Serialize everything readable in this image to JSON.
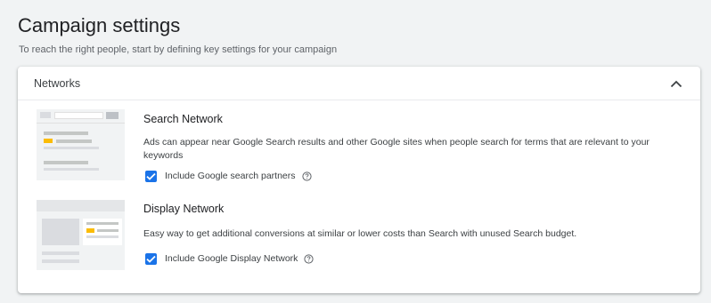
{
  "page": {
    "title": "Campaign settings",
    "subtitle": "To reach the right people, start by defining key settings for your campaign"
  },
  "networks_panel": {
    "title": "Networks",
    "collapse_icon": "chevron-up-icon",
    "search_network": {
      "title": "Search Network",
      "description": "Ads can appear near Google Search results and other Google sites when people search for terms that are relevant to your keywords",
      "checkbox_label": "Include Google search partners",
      "checked": true,
      "help_icon": "help-circle-icon",
      "illustration_icon": "search-results-illustration"
    },
    "display_network": {
      "title": "Display Network",
      "description": "Easy way to get additional conversions at similar or lower costs than Search with unused Search budget.",
      "checkbox_label": "Include Google Display Network",
      "checked": true,
      "help_icon": "help-circle-icon",
      "illustration_icon": "display-ads-illustration"
    }
  },
  "colors": {
    "background": "#f1f3f4",
    "card": "#ffffff",
    "accent": "#1a73e8",
    "ad_highlight": "#fbbc04",
    "text_primary": "#202124",
    "text_secondary": "#5f6368"
  }
}
